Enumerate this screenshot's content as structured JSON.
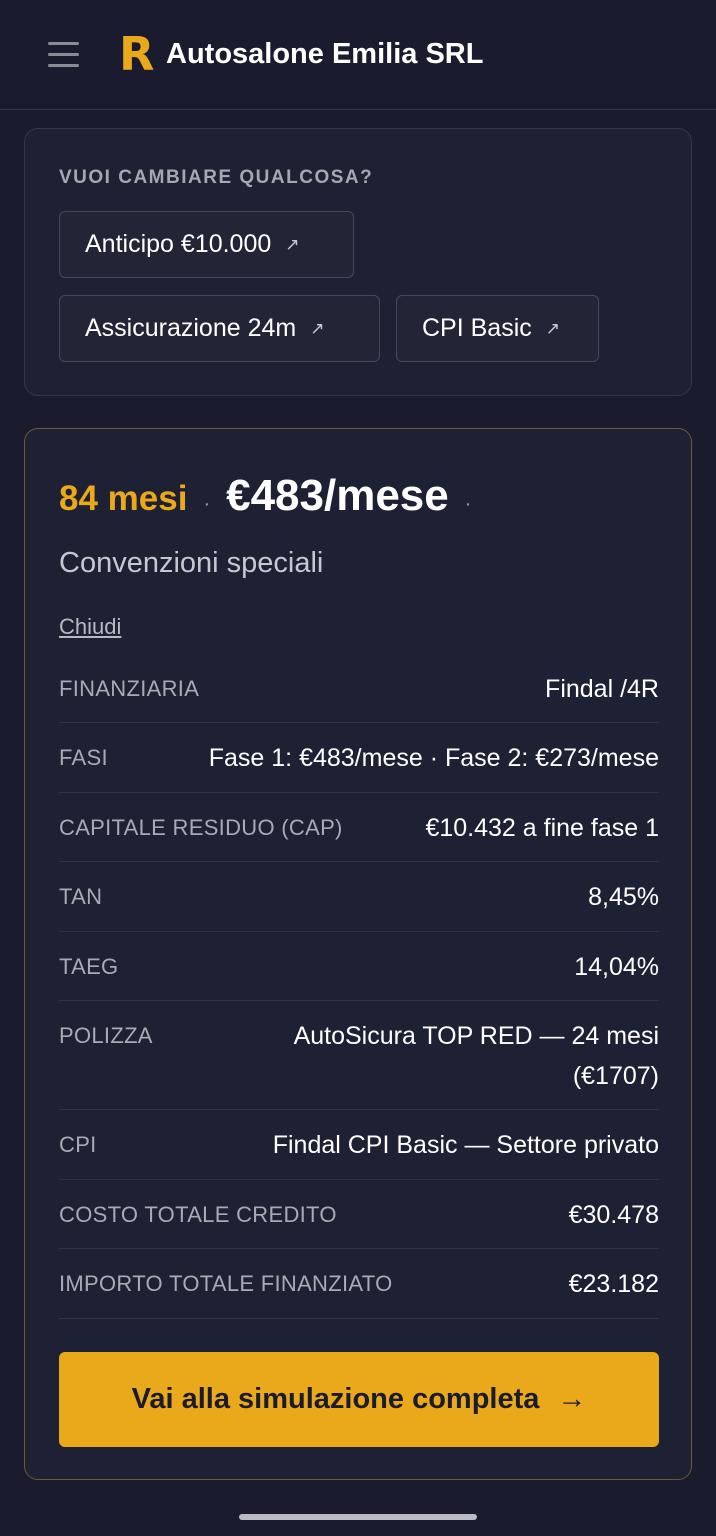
{
  "header": {
    "logo_letter": "R",
    "title": "Autosalone Emilia SRL"
  },
  "change_panel": {
    "label": "VUOI CAMBIARE QUALCOSA?",
    "chips": [
      {
        "label": "Anticipo €10.000",
        "icon": "↗"
      },
      {
        "label": "Assicurazione 24m",
        "icon": "↗"
      },
      {
        "label": "CPI Basic",
        "icon": "↗"
      }
    ]
  },
  "offer": {
    "months": "84 mesi",
    "separator": "·",
    "monthly": "€483/mese",
    "trailing_separator": "·",
    "subtitle": "Convenzioni speciali",
    "close_label": "Chiudi",
    "details": [
      {
        "key": "FINANZIARIA",
        "value": "Findal /4R"
      },
      {
        "key": "FASI",
        "value": "Fase 1: €483/mese · Fase 2: €273/mese"
      },
      {
        "key": "CAPITALE RESIDUO (CAP)",
        "value": "€10.432 a fine fase 1"
      },
      {
        "key": "TAN",
        "value": "8,45%"
      },
      {
        "key": "TAEG",
        "value": "14,04%"
      },
      {
        "key": "POLIZZA",
        "value_line1": "AutoSicura TOP RED — 24 mesi",
        "value_line2": "(€1707)"
      },
      {
        "key": "CPI",
        "value": "Findal CPI Basic — Settore privato"
      },
      {
        "key": "COSTO TOTALE CREDITO",
        "value": "€30.478"
      },
      {
        "key": "IMPORTO TOTALE FINANZIATO",
        "value": "€23.182"
      }
    ],
    "cta_label": "Vai alla simulazione completa",
    "cta_arrow": "→"
  },
  "colors": {
    "background": "#1a1b2e",
    "accent": "#eaa91a",
    "card": "#1e2033"
  }
}
